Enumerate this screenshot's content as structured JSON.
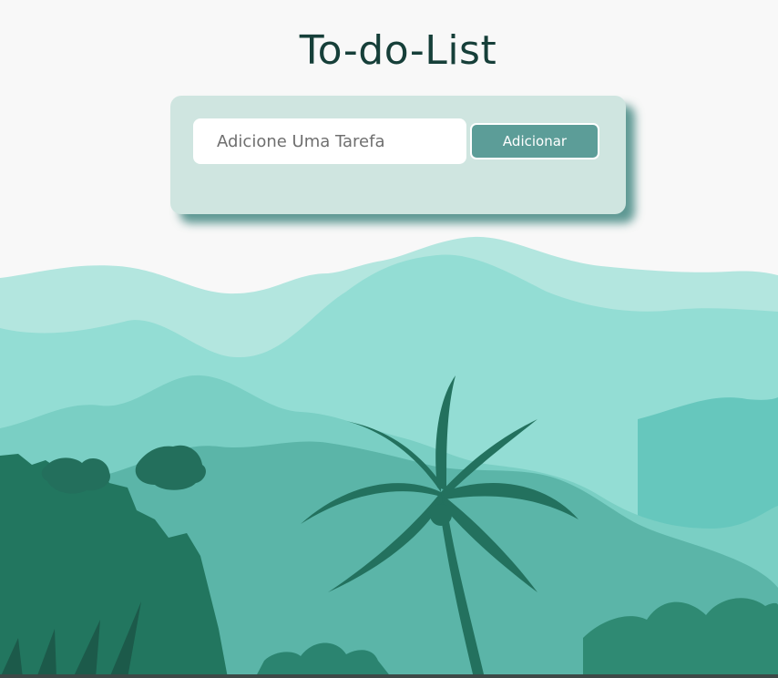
{
  "header": {
    "title": "To-do-List"
  },
  "form": {
    "input_placeholder": "Adicione Uma Tarefa",
    "input_value": "",
    "add_label": "Adicionar"
  },
  "colors": {
    "title": "#163f39",
    "card_background": "#cfe5e0",
    "button_background": "#5c9d98",
    "mountain_far": "#b3e6df",
    "mountain_mid": "#93ddd4",
    "forest_dark": "#22765f"
  }
}
